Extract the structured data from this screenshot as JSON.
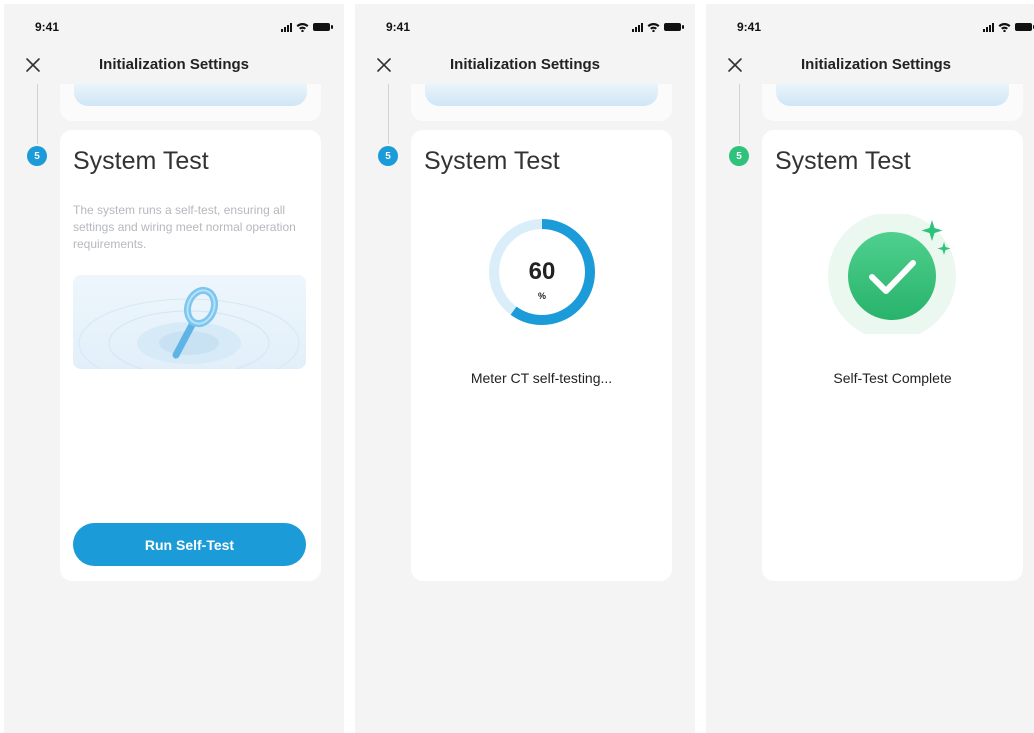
{
  "status_bar": {
    "time": "9:41"
  },
  "header": {
    "title": "Initialization Settings"
  },
  "step": {
    "number": "5",
    "title": "System Test"
  },
  "screen1": {
    "description": "The system runs a self-test, ensuring all settings and wiring meet normal operation requirements.",
    "button_label": "Run Self-Test"
  },
  "screen2": {
    "progress_value": "60",
    "progress_unit": "%",
    "progress_fraction": 0.6,
    "status": "Meter CT self-testing..."
  },
  "screen3": {
    "status": "Self-Test Complete"
  },
  "colors": {
    "accent": "#1b9bd7",
    "success": "#2ec27a",
    "background": "#f4f4f5",
    "card": "#ffffff"
  },
  "icons": [
    "close-icon",
    "signal-icon",
    "wifi-icon",
    "battery-icon",
    "magnifier-icon",
    "checkmark-icon",
    "sparkle-icon"
  ]
}
